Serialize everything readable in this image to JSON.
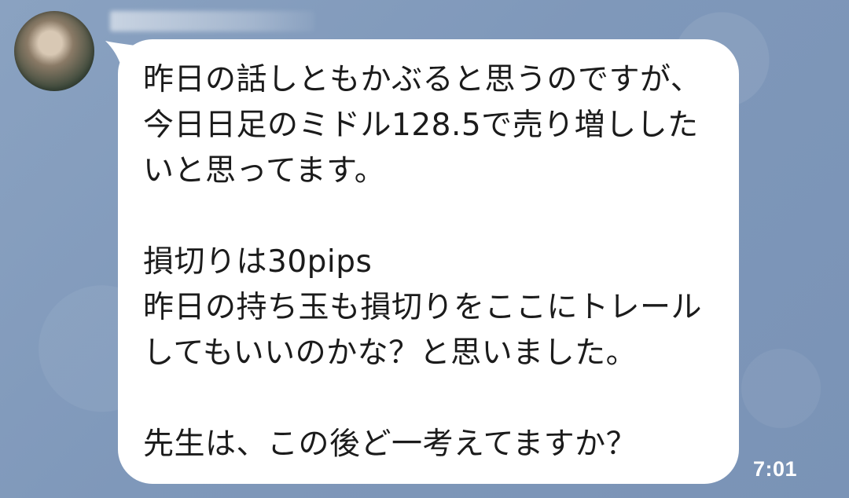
{
  "sender": {
    "name": "",
    "avatar_icon": "avatar-photo"
  },
  "message": {
    "text": "昨日の話しともかぶると思うのですが、今日日足のミドル128.5で売り増ししたいと思ってます。\n\n損切りは30pips\n昨日の持ち玉も損切りをここにトレールしてもいいのかな？と思いました。\n\n先生は、この後ど一考えてますか？",
    "timestamp": "7:01"
  },
  "colors": {
    "background": "#8aa2c1",
    "bubble": "#ffffff",
    "text": "#1b1b1b",
    "timestamp": "#ffffff"
  }
}
